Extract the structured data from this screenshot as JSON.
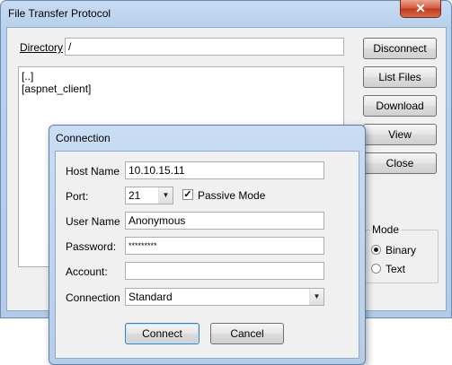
{
  "window": {
    "title": "File Transfer Protocol",
    "close_glyph": "✕"
  },
  "directory": {
    "label": "Directory",
    "value": "/"
  },
  "listing": [
    "[..]",
    "[aspnet_client]"
  ],
  "buttons": {
    "disconnect": "Disconnect",
    "list_files": "List Files",
    "download": "Download",
    "view": "View",
    "close": "Close"
  },
  "mode": {
    "label": "Mode",
    "options": [
      "Binary",
      "Text"
    ],
    "selected": "Binary"
  },
  "dialog": {
    "title": "Connection",
    "host_label": "Host Name",
    "host_value": "10.10.15.11",
    "port_label": "Port:",
    "port_value": "21",
    "passive_label": "Passive Mode",
    "passive_checked": true,
    "check_glyph": "✓",
    "user_label": "User Name",
    "user_value": "Anonymous",
    "password_label": "Password:",
    "password_value": "*********",
    "account_label": "Account:",
    "account_value": "",
    "connection_label": "Connection",
    "connection_value": "Standard",
    "dropdown_glyph": "▼",
    "connect": "Connect",
    "cancel": "Cancel"
  }
}
